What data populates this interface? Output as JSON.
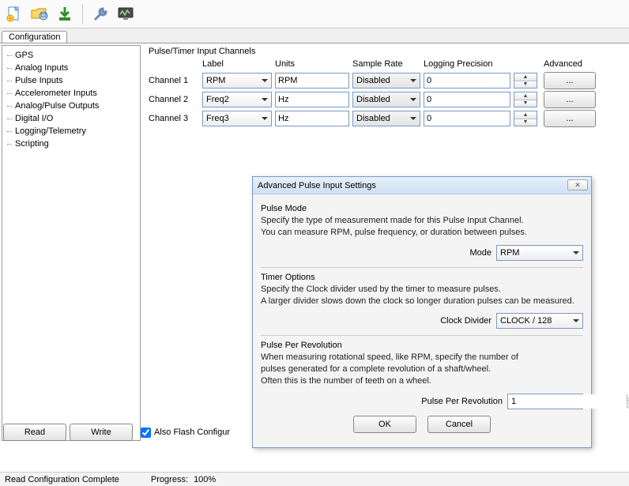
{
  "toolbar": {
    "icons": [
      "new-file-icon",
      "open-folder-icon",
      "download-icon",
      "wrench-icon",
      "monitor-icon"
    ]
  },
  "tabs": {
    "active": "Configuration"
  },
  "sidebar": {
    "items": [
      "GPS",
      "Analog Inputs",
      "Pulse Inputs",
      "Accelerometer Inputs",
      "Analog/Pulse Outputs",
      "Digital I/O",
      "Logging/Telemetry",
      "Scripting"
    ],
    "selected_index": 2
  },
  "section": {
    "title": "Pulse/Timer Input Channels",
    "headers": {
      "label": "Label",
      "units": "Units",
      "sample_rate": "Sample Rate",
      "logging_precision": "Logging Precision",
      "advanced": "Advanced"
    },
    "channels": [
      {
        "name": "Channel 1",
        "label": "RPM",
        "units": "RPM",
        "sample_rate": "Disabled",
        "precision": "0",
        "adv": "..."
      },
      {
        "name": "Channel 2",
        "label": "Freq2",
        "units": "Hz",
        "sample_rate": "Disabled",
        "precision": "0",
        "adv": "..."
      },
      {
        "name": "Channel 3",
        "label": "Freq3",
        "units": "Hz",
        "sample_rate": "Disabled",
        "precision": "0",
        "adv": "..."
      }
    ]
  },
  "bottom": {
    "read": "Read",
    "write": "Write",
    "flash_label": "Also Flash Configur"
  },
  "statusbar": {
    "status": "Read Configuration Complete",
    "progress_label": "Progress:",
    "progress_value": "100%"
  },
  "dialog": {
    "title": "Advanced Pulse Input Settings",
    "pulse_mode": {
      "heading": "Pulse Mode",
      "desc1": "Specify the type of measurement made for this Pulse Input Channel.",
      "desc2": "You can measure RPM, pulse frequency, or duration between pulses.",
      "mode_label": "Mode",
      "mode_value": "RPM"
    },
    "timer_options": {
      "heading": "Timer  Options",
      "desc1": "Specify the Clock divider used by the timer to measure pulses.",
      "desc2": "A larger divider slows down the clock so longer duration pulses can be measured.",
      "clock_label": "Clock Divider",
      "clock_value": "CLOCK / 128"
    },
    "ppr": {
      "heading": "Pulse Per Revolution",
      "desc1": "When measuring rotational speed, like RPM, specify the number of",
      "desc2": "pulses generated for a complete revolution of a shaft/wheel.",
      "desc3": "Often this is the number of teeth on a wheel.",
      "label": "Pulse Per Revolution",
      "value": "1"
    },
    "buttons": {
      "ok": "OK",
      "cancel": "Cancel"
    }
  }
}
